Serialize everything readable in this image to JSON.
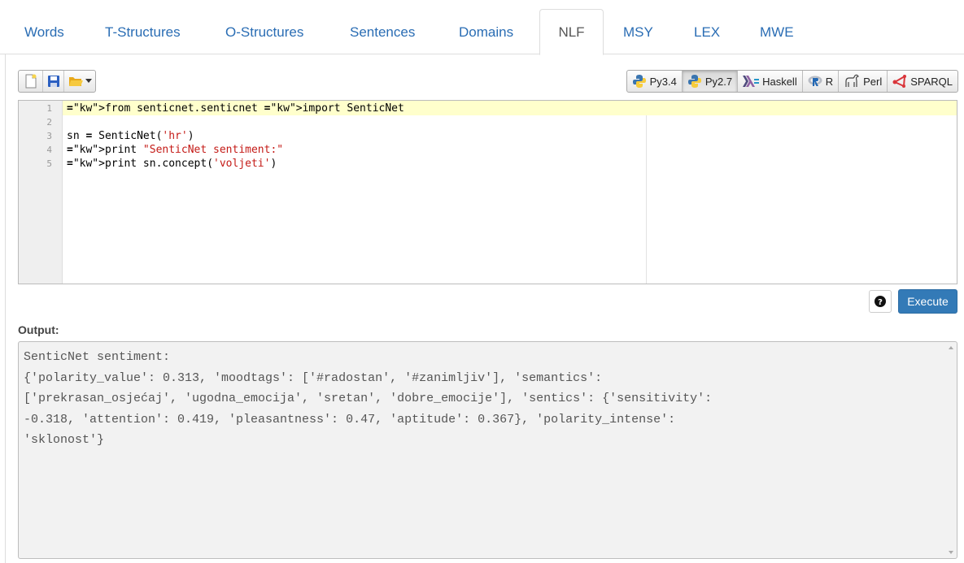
{
  "tabs": [
    {
      "label": "Words"
    },
    {
      "label": "T-Structures"
    },
    {
      "label": "O-Structures"
    },
    {
      "label": "Sentences"
    },
    {
      "label": "Domains"
    },
    {
      "label": "NLF",
      "active": true
    },
    {
      "label": "MSY"
    },
    {
      "label": "LEX"
    },
    {
      "label": "MWE"
    }
  ],
  "toolbar": {
    "new_icon": "new-file-icon",
    "save_icon": "save-icon",
    "open_icon": "open-folder-icon",
    "dropdown_icon": "caret-down-icon"
  },
  "languages": [
    {
      "label": "Py3.4",
      "icon": "python-icon"
    },
    {
      "label": "Py2.7",
      "icon": "python-icon",
      "selected": true
    },
    {
      "label": "Haskell",
      "icon": "haskell-icon"
    },
    {
      "label": "R",
      "icon": "r-icon"
    },
    {
      "label": "Perl",
      "icon": "perl-icon"
    },
    {
      "label": "SPARQL",
      "icon": "sparql-icon"
    }
  ],
  "editor": {
    "line_numbers": [
      "1",
      "2",
      "3",
      "4",
      "5"
    ],
    "code_lines": [
      "from senticnet.senticnet import SenticNet",
      "",
      "sn = SenticNet('hr')",
      "print \"SenticNet sentiment:\"",
      "print sn.concept('voljeti')"
    ]
  },
  "actions": {
    "help_icon": "question-circle-icon",
    "execute_label": "Execute"
  },
  "output": {
    "label": "Output:",
    "lines": [
      "SenticNet sentiment:",
      "{'polarity_value': 0.313, 'moodtags': ['#radostan', '#zanimljiv'], 'semantics':",
      "['prekrasan_osjećaj', 'ugodna_emocija', 'sretan', 'dobre_emocije'], 'sentics': {'sensitivity':",
      "-0.318, 'attention': 0.419, 'pleasantness': 0.47, 'aptitude': 0.367}, 'polarity_intense':",
      "'sklonost'}"
    ]
  },
  "colors": {
    "tab_link": "#2a6db4",
    "execute_bg": "#337ab7",
    "active_line": "#ffffcc",
    "string": "#c41a16"
  }
}
